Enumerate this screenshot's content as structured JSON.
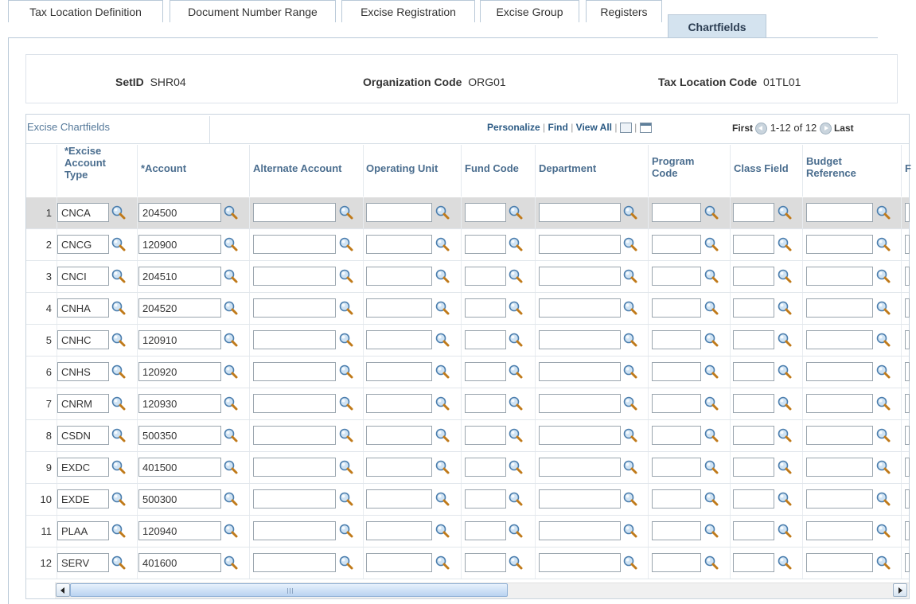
{
  "tabs": [
    {
      "label": "Tax Location Definition",
      "active": false
    },
    {
      "label": "Document Number Range",
      "active": false
    },
    {
      "label": "Excise Registration",
      "active": false
    },
    {
      "label": "Excise Group",
      "active": false
    },
    {
      "label": "Registers",
      "active": false
    },
    {
      "label": "Chartfields",
      "active": true
    }
  ],
  "header": {
    "setid_label": "SetID",
    "setid_value": "SHR04",
    "org_label": "Organization Code",
    "org_value": "ORG01",
    "taxloc_label": "Tax Location Code",
    "taxloc_value": "01TL01"
  },
  "grid": {
    "title": "Excise Chartfields",
    "personalize": "Personalize",
    "find": "Find",
    "view_all": "View All",
    "first": "First",
    "range": "1-12 of 12",
    "last": "Last",
    "columns": {
      "excise_type": "*Excise Account Type",
      "account": "*Account",
      "alt_account": "Alternate Account",
      "operating_unit": "Operating Unit",
      "fund_code": "Fund Code",
      "department": "Department",
      "program_code": "Program Code",
      "class_field": "Class Field",
      "budget_reference": "Budget Reference",
      "truncated": "F"
    },
    "rows": [
      {
        "num": "1",
        "type": "CNCA",
        "account": "204500",
        "selected": true
      },
      {
        "num": "2",
        "type": "CNCG",
        "account": "120900",
        "selected": false
      },
      {
        "num": "3",
        "type": "CNCI",
        "account": "204510",
        "selected": false
      },
      {
        "num": "4",
        "type": "CNHA",
        "account": "204520",
        "selected": false
      },
      {
        "num": "5",
        "type": "CNHC",
        "account": "120910",
        "selected": false
      },
      {
        "num": "6",
        "type": "CNHS",
        "account": "120920",
        "selected": false
      },
      {
        "num": "7",
        "type": "CNRM",
        "account": "120930",
        "selected": false
      },
      {
        "num": "8",
        "type": "CSDN",
        "account": "500350",
        "selected": false
      },
      {
        "num": "9",
        "type": "EXDC",
        "account": "401500",
        "selected": false
      },
      {
        "num": "10",
        "type": "EXDE",
        "account": "500300",
        "selected": false
      },
      {
        "num": "11",
        "type": "PLAA",
        "account": "120940",
        "selected": false
      },
      {
        "num": "12",
        "type": "SERV",
        "account": "401600",
        "selected": false
      }
    ]
  },
  "colors": {
    "tab_active_bg": "#d4e3ef",
    "link": "#2b5a84",
    "header_text": "#4b6e8f",
    "selected_row": "#dcdcdc"
  }
}
